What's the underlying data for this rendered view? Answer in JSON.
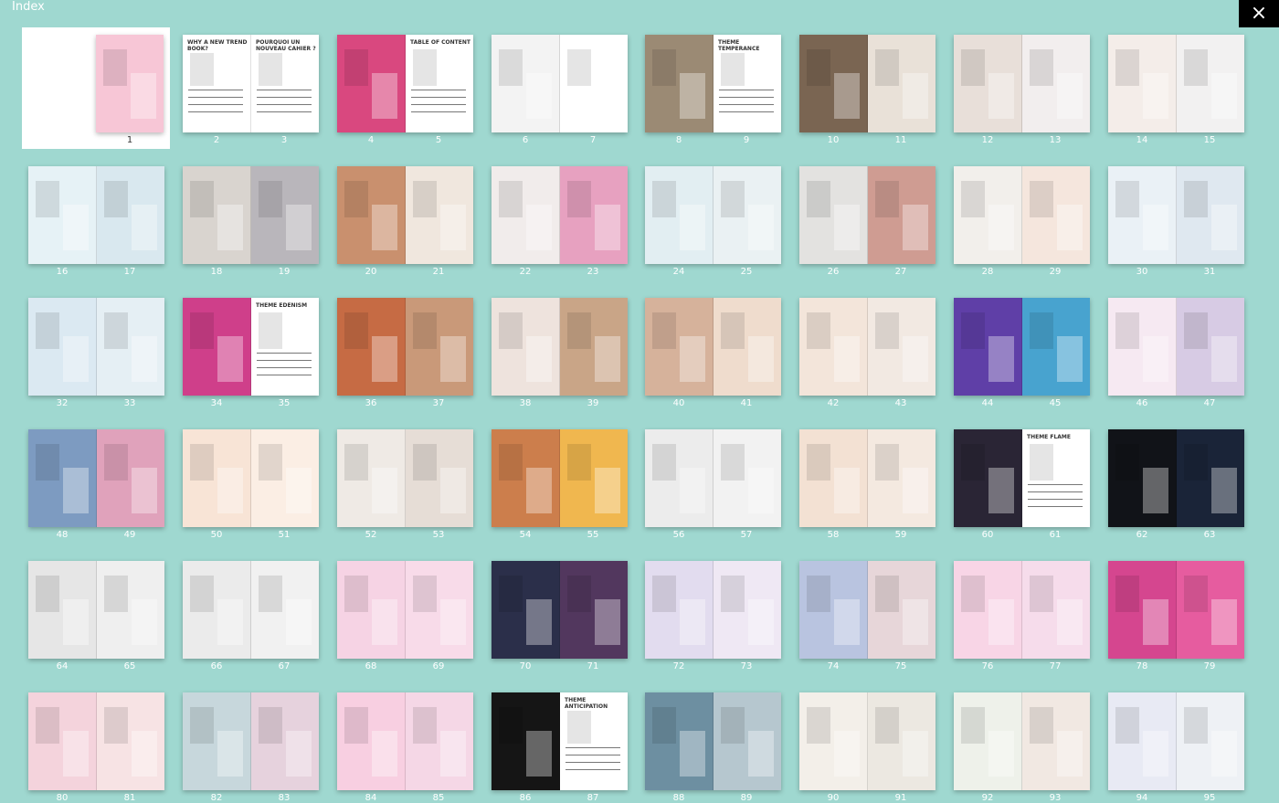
{
  "header": {
    "title": "Index",
    "close_icon": "×"
  },
  "spreads": [
    {
      "pages": [
        "1"
      ]
    },
    {
      "pages": [
        "2",
        "3"
      ]
    },
    {
      "pages": [
        "4",
        "5"
      ]
    },
    {
      "pages": [
        "6",
        "7"
      ]
    },
    {
      "pages": [
        "8",
        "9"
      ]
    },
    {
      "pages": [
        "10",
        "11"
      ]
    },
    {
      "pages": [
        "12",
        "13"
      ]
    },
    {
      "pages": [
        "14",
        "15"
      ]
    },
    {
      "pages": [
        "16",
        "17"
      ]
    },
    {
      "pages": [
        "18",
        "19"
      ]
    },
    {
      "pages": [
        "20",
        "21"
      ]
    },
    {
      "pages": [
        "22",
        "23"
      ]
    },
    {
      "pages": [
        "24",
        "25"
      ]
    },
    {
      "pages": [
        "26",
        "27"
      ]
    },
    {
      "pages": [
        "28",
        "29"
      ]
    },
    {
      "pages": [
        "30",
        "31"
      ]
    },
    {
      "pages": [
        "32",
        "33"
      ]
    },
    {
      "pages": [
        "34",
        "35"
      ]
    },
    {
      "pages": [
        "36",
        "37"
      ]
    },
    {
      "pages": [
        "38",
        "39"
      ]
    },
    {
      "pages": [
        "40",
        "41"
      ]
    },
    {
      "pages": [
        "42",
        "43"
      ]
    },
    {
      "pages": [
        "44",
        "45"
      ]
    },
    {
      "pages": [
        "46",
        "47"
      ]
    },
    {
      "pages": [
        "48",
        "49"
      ]
    },
    {
      "pages": [
        "50",
        "51"
      ]
    },
    {
      "pages": [
        "52",
        "53"
      ]
    },
    {
      "pages": [
        "54",
        "55"
      ]
    },
    {
      "pages": [
        "56",
        "57"
      ]
    },
    {
      "pages": [
        "58",
        "59"
      ]
    },
    {
      "pages": [
        "60",
        "61"
      ]
    },
    {
      "pages": [
        "62",
        "63"
      ]
    },
    {
      "pages": [
        "64",
        "65"
      ]
    },
    {
      "pages": [
        "66",
        "67"
      ]
    },
    {
      "pages": [
        "68",
        "69"
      ]
    },
    {
      "pages": [
        "70",
        "71"
      ]
    },
    {
      "pages": [
        "72",
        "73"
      ]
    },
    {
      "pages": [
        "74",
        "75"
      ]
    },
    {
      "pages": [
        "76",
        "77"
      ]
    },
    {
      "pages": [
        "78",
        "79"
      ]
    },
    {
      "pages": [
        "80",
        "81"
      ]
    },
    {
      "pages": [
        "82",
        "83"
      ]
    },
    {
      "pages": [
        "84",
        "85"
      ]
    },
    {
      "pages": [
        "86",
        "87"
      ]
    },
    {
      "pages": [
        "88",
        "89"
      ]
    },
    {
      "pages": [
        "90",
        "91"
      ]
    },
    {
      "pages": [
        "92",
        "93"
      ]
    },
    {
      "pages": [
        "94",
        "95"
      ]
    }
  ],
  "page_texts": {
    "2": "WHY A NEW TREND BOOK?",
    "3": "POURQUOI UN NOUVEAU CAHIER ?",
    "5": "TABLE OF CONTENT",
    "9": "THEME TEMPERANCE",
    "35": "THEME EDENISM",
    "61": "THEME FLAME",
    "87": "THEME ANTICIPATION"
  },
  "palette": {
    "background": "#9fd8d0",
    "page_colors": {
      "1": "#f7c6d6",
      "2": "#ffffff",
      "3": "#ffffff",
      "4": "#d9487f",
      "5": "#ffffff",
      "6": "#f3f3f3",
      "7": "#ffffff",
      "8": "#9b8a74",
      "9": "#ffffff",
      "10": "#7a6552",
      "11": "#e9e1d8",
      "12": "#e8dfd9",
      "13": "#f2eeee",
      "14": "#f4ede9",
      "15": "#f2f1f1",
      "16": "#e6f2f6",
      "17": "#d9e8ef",
      "18": "#d9d4cf",
      "19": "#b9b6bb",
      "20": "#c9906e",
      "21": "#f0e7de",
      "22": "#f1eceb",
      "23": "#e7a1c0",
      "24": "#e2eef2",
      "25": "#eaf1f3",
      "26": "#e3e2e0",
      "27": "#cf9c92",
      "28": "#f2efeb",
      "29": "#f5e6dd",
      "30": "#eaf1f6",
      "31": "#dfe8f0",
      "32": "#dbe9f2",
      "33": "#e5eff4",
      "34": "#cf3f8a",
      "35": "#ffffff",
      "36": "#c66b44",
      "37": "#c99979",
      "38": "#eee3dd",
      "39": "#c9a587",
      "40": "#d6b29b",
      "41": "#efdccd",
      "42": "#f3e5da",
      "43": "#f2e9e2",
      "44": "#5f3fa7",
      "45": "#48a3cf",
      "46": "#f6e9f2",
      "47": "#d7cbe4",
      "48": "#7d9bc1",
      "49": "#e0a2bb",
      "50": "#f8e4d6",
      "51": "#fbeee4",
      "52": "#efeae5",
      "53": "#e6ddd6",
      "54": "#cc7e4c",
      "55": "#f0b74f",
      "56": "#ececec",
      "57": "#f2f2f2",
      "58": "#f3e1d3",
      "59": "#f4e9e0",
      "60": "#2a2535",
      "61": "#ffffff",
      "62": "#111318",
      "63": "#1a2438",
      "64": "#e6e6e6",
      "65": "#efefef",
      "66": "#ebebeb",
      "67": "#f1f1f1",
      "68": "#f6d3e4",
      "69": "#f8dbe9",
      "70": "#2b2f4a",
      "71": "#52375e",
      "72": "#e2dcef",
      "73": "#efe8f4",
      "74": "#b9c4e0",
      "75": "#e7d6d9",
      "76": "#f8d5e6",
      "77": "#f6dceb",
      "78": "#d5468f",
      "79": "#e65c9f",
      "80": "#f4d3dc",
      "81": "#f7e3e4",
      "82": "#c7d7dc",
      "83": "#e6d2dd",
      "84": "#f8cfe1",
      "85": "#f5d7e6",
      "86": "#151515",
      "87": "#ffffff",
      "88": "#6d8fa1",
      "89": "#b6c7cf",
      "90": "#f3efe9",
      "91": "#ece8e1",
      "92": "#eef1ea",
      "93": "#f1e8e2",
      "94": "#e8eaf4",
      "95": "#eef1f5"
    }
  }
}
